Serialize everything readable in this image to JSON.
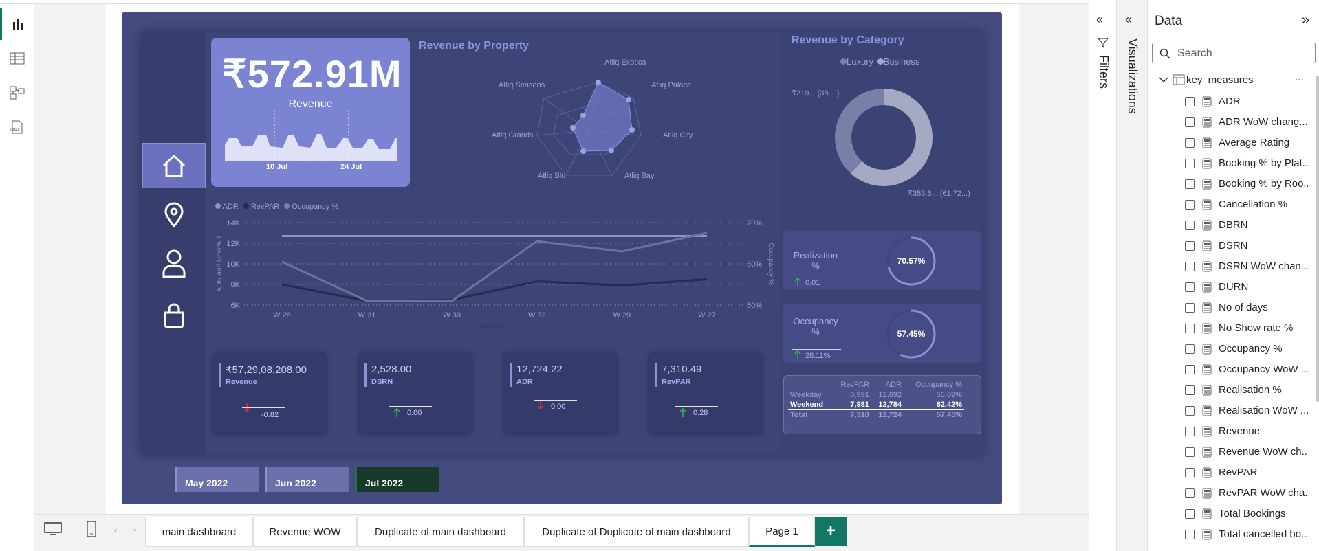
{
  "dashboard": {
    "revenue_big": "₹572.91M",
    "revenue_big_label": "Revenue",
    "sparkline_ticks": [
      "10 Jul",
      "24 Jul"
    ],
    "radar": {
      "title": "Revenue by Property",
      "labels": [
        "Atliq Exotica",
        "Atliq Palace",
        "Atliq City",
        "Atliq Bay",
        "Atliq Blu",
        "Atliq Grands",
        "Atliq Seasons"
      ]
    },
    "donut": {
      "title": "Revenue by Category",
      "legend": [
        "Luxury",
        "Business"
      ],
      "label_top": "₹219... (38....)",
      "label_bottom": "₹353.6... (61.72...)"
    },
    "line_legend": [
      "ADR",
      "RevPAR",
      "Occupancy %"
    ],
    "line_ylabel": "ADR and RevPAR",
    "line_y2label": "Occupancy %",
    "line_xlabel": "week no",
    "cards": [
      {
        "value": "₹57,29,08,208.00",
        "label": "Revenue",
        "delta": "-0.82",
        "dir": "down"
      },
      {
        "value": "2,528.00",
        "label": "DSRN",
        "delta": "0.00",
        "dir": "up"
      },
      {
        "value": "12,724.22",
        "label": "ADR",
        "delta": "0.00",
        "dir": "down"
      },
      {
        "value": "7,310.49",
        "label": "RevPAR",
        "delta": "0.28",
        "dir": "up"
      }
    ],
    "realization": {
      "label": "Realization %",
      "value": "70.57%",
      "delta": "0.01",
      "pct": 0.7057
    },
    "occupancy": {
      "label": "Occupancy %",
      "value": "57.45%",
      "delta": "28.11%",
      "pct": 0.5745
    },
    "table": {
      "headers": [
        "",
        "RevPAR",
        "ADR",
        "Occupancy %"
      ],
      "rows": [
        [
          "Weekday",
          "6,991",
          "12,692",
          "55.09%"
        ],
        [
          "Weekend",
          "7,981",
          "12,784",
          "62.42%"
        ],
        [
          "Total",
          "7,310",
          "12,724",
          "57.45%"
        ]
      ]
    },
    "months": [
      "May 2022",
      "Jun 2022",
      "Jul 2022"
    ]
  },
  "chart_data": {
    "type": "line",
    "x": [
      "W 28",
      "W 31",
      "W 30",
      "W 32",
      "W 29",
      "W 27"
    ],
    "xlabel": "week no",
    "ylabel": "ADR and RevPAR",
    "y2label": "Occupancy %",
    "yticks": [
      "14K",
      "12K",
      "10K",
      "8K",
      "6K"
    ],
    "y2ticks": [
      "70%",
      "60%",
      "50%"
    ],
    "ylim": [
      6000,
      14000
    ],
    "y2lim": [
      50,
      70
    ],
    "series": [
      {
        "name": "ADR",
        "axis": "left",
        "values": [
          12700,
          12700,
          12700,
          12700,
          12700,
          12700
        ]
      },
      {
        "name": "RevPAR",
        "axis": "left",
        "values": [
          8000,
          6400,
          6500,
          8300,
          7900,
          8500
        ]
      },
      {
        "name": "Occupancy %",
        "axis": "right",
        "values": [
          60.5,
          51.0,
          51.0,
          65.5,
          63.0,
          67.5
        ]
      }
    ]
  },
  "pages": {
    "tabs": [
      "main dashboard",
      "Revenue WOW",
      "Duplicate of main dashboard",
      "Duplicate of Duplicate of main dashboard",
      "Page 1"
    ],
    "add": "+"
  },
  "panes": {
    "filters": "Filters",
    "visualizations": "Visualizations",
    "data_title": "Data",
    "search_placeholder": "Search",
    "table_name": "key_measures",
    "fields": [
      "ADR",
      "ADR WoW chang...",
      "Average Rating",
      "Booking % by Plat...",
      "Booking % by Roo...",
      "Cancellation %",
      "DBRN",
      "DSRN",
      "DSRN WoW chan...",
      "DURN",
      "No of days",
      "No Show rate %",
      "Occupancy %",
      "Occupancy WoW ...",
      "Realisation %",
      "Realisation WoW ...",
      "Revenue",
      "Revenue WoW ch...",
      "RevPAR",
      "RevPAR WoW cha...",
      "Total Bookings",
      "Total cancelled bo..."
    ],
    "more": "..."
  },
  "colors": {
    "accent": "#117865",
    "report_bg": "#444b7e",
    "kpi": "#7b83d3"
  }
}
